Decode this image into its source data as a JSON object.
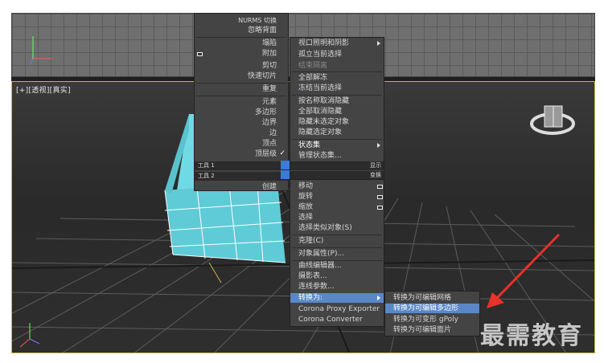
{
  "viewport": {
    "label": "[+][透视][真实]"
  },
  "quad_top_left": {
    "items": [
      "NURMS 切换",
      "忽略背面",
      "塌陷",
      "附加",
      "剪切",
      "快速切片",
      "重复",
      "元素",
      "多边形",
      "边界",
      "边",
      "顶点",
      "顶层级",
      "创建"
    ],
    "checked_item": "顶层级",
    "header1": "工具 1",
    "header2": "工具 2"
  },
  "quad_top_right": {
    "items": [
      "视口照明和阴影",
      "孤立当前选择",
      "结束隔离",
      "全部解冻",
      "冻结当前选择",
      "按名称取消隐藏",
      "全部取消隐藏",
      "隐藏未选定对象",
      "隐藏选定对象",
      "状态集",
      "管理状态集..."
    ],
    "header1": "显示",
    "header2": "变换"
  },
  "quad_bottom_right": {
    "items": [
      "移动",
      "旋转",
      "缩放",
      "选择",
      "选择类似对象(S)",
      "克隆(C)",
      "对象属性(P)...",
      "曲线编辑器...",
      "摄影表...",
      "连线参数...",
      "转换为:",
      "Corona Proxy Exporter",
      "Corona Converter"
    ]
  },
  "submenu": {
    "items": [
      "转换为可编辑网格",
      "转换为可编辑多边形",
      "转换为可变形 gPoly",
      "转换为可编辑面片"
    ],
    "selected": "转换为可编辑多边形"
  },
  "watermark": "最需教育",
  "colors": {
    "menu_bg": "#444444",
    "highlight": "#5a88c6",
    "cube": "#5fcbd6",
    "arrow": "#e8322a"
  }
}
